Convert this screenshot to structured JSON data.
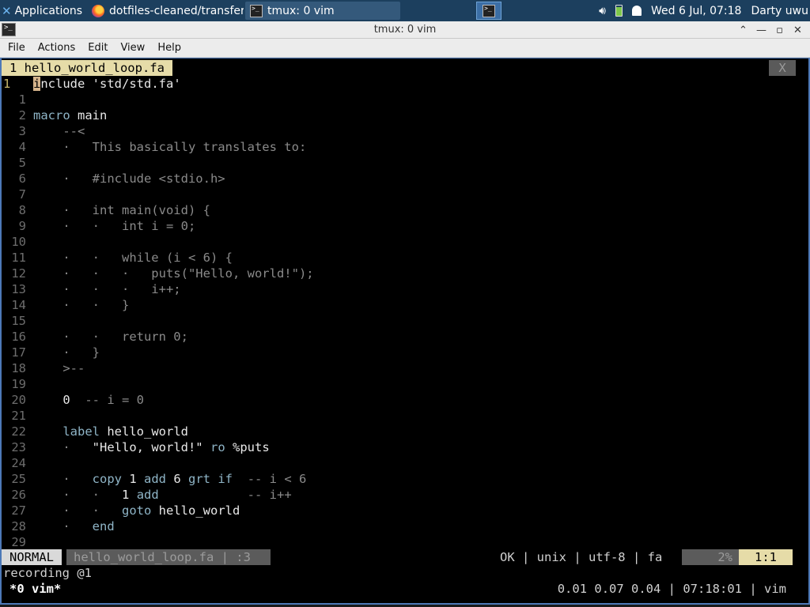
{
  "panel": {
    "applications_label": "Applications",
    "tasks": [
      {
        "label": "dotfiles-cleaned/transfer...",
        "icon": "firefox-icon"
      },
      {
        "label": "tmux: 0 vim",
        "icon": "terminal-icon"
      }
    ],
    "clock": "Wed  6 Jul, 07:18",
    "user": "Darty uwu"
  },
  "window": {
    "title": "tmux: 0 vim",
    "menu": [
      "File",
      "Actions",
      "Edit",
      "View",
      "Help"
    ]
  },
  "vim": {
    "tab_label": "1 hello_world_loop.fa",
    "tab_close": "X",
    "lines": [
      {
        "n": "1",
        "text": "include 'std/std.fa'"
      },
      {
        "n": "1",
        "text": ""
      },
      {
        "n": "2",
        "text": "macro main"
      },
      {
        "n": "3",
        "text": "    --<"
      },
      {
        "n": "4",
        "text": "    ·   This basically translates to:"
      },
      {
        "n": "5",
        "text": ""
      },
      {
        "n": "6",
        "text": "    ·   #include <stdio.h>"
      },
      {
        "n": "7",
        "text": ""
      },
      {
        "n": "8",
        "text": "    ·   int main(void) {"
      },
      {
        "n": "9",
        "text": "    ·   ·   int i = 0;"
      },
      {
        "n": "10",
        "text": ""
      },
      {
        "n": "11",
        "text": "    ·   ·   while (i < 6) {"
      },
      {
        "n": "12",
        "text": "    ·   ·   ·   puts(\"Hello, world!\");"
      },
      {
        "n": "13",
        "text": "    ·   ·   ·   i++;"
      },
      {
        "n": "14",
        "text": "    ·   ·   }"
      },
      {
        "n": "15",
        "text": ""
      },
      {
        "n": "16",
        "text": "    ·   ·   return 0;"
      },
      {
        "n": "17",
        "text": "    ·   }"
      },
      {
        "n": "18",
        "text": "    >--"
      },
      {
        "n": "19",
        "text": ""
      },
      {
        "n": "20",
        "text": "    0  -- i = 0"
      },
      {
        "n": "21",
        "text": ""
      },
      {
        "n": "22",
        "text": "    label hello_world"
      },
      {
        "n": "23",
        "text": "    ·   \"Hello, world!\" ro %puts"
      },
      {
        "n": "24",
        "text": ""
      },
      {
        "n": "25",
        "text": "    ·   copy 1 add 6 grt if  -- i < 6"
      },
      {
        "n": "26",
        "text": "    ·   ·   1 add            -- i++"
      },
      {
        "n": "27",
        "text": "    ·   ·   goto hello_world"
      },
      {
        "n": "28",
        "text": "    ·   end"
      },
      {
        "n": "29",
        "text": ""
      }
    ],
    "status": {
      "mode": "NORMAL",
      "file": "hello_world_loop.fa | :3",
      "info": "OK | unix | utf-8 | fa",
      "percent": "2%",
      "position": "1:1"
    },
    "cmdline": "recording @1"
  },
  "tmux": {
    "window": "*0 vim*",
    "right": "0.01 0.07 0.04 | 07:18:01 | vim"
  }
}
